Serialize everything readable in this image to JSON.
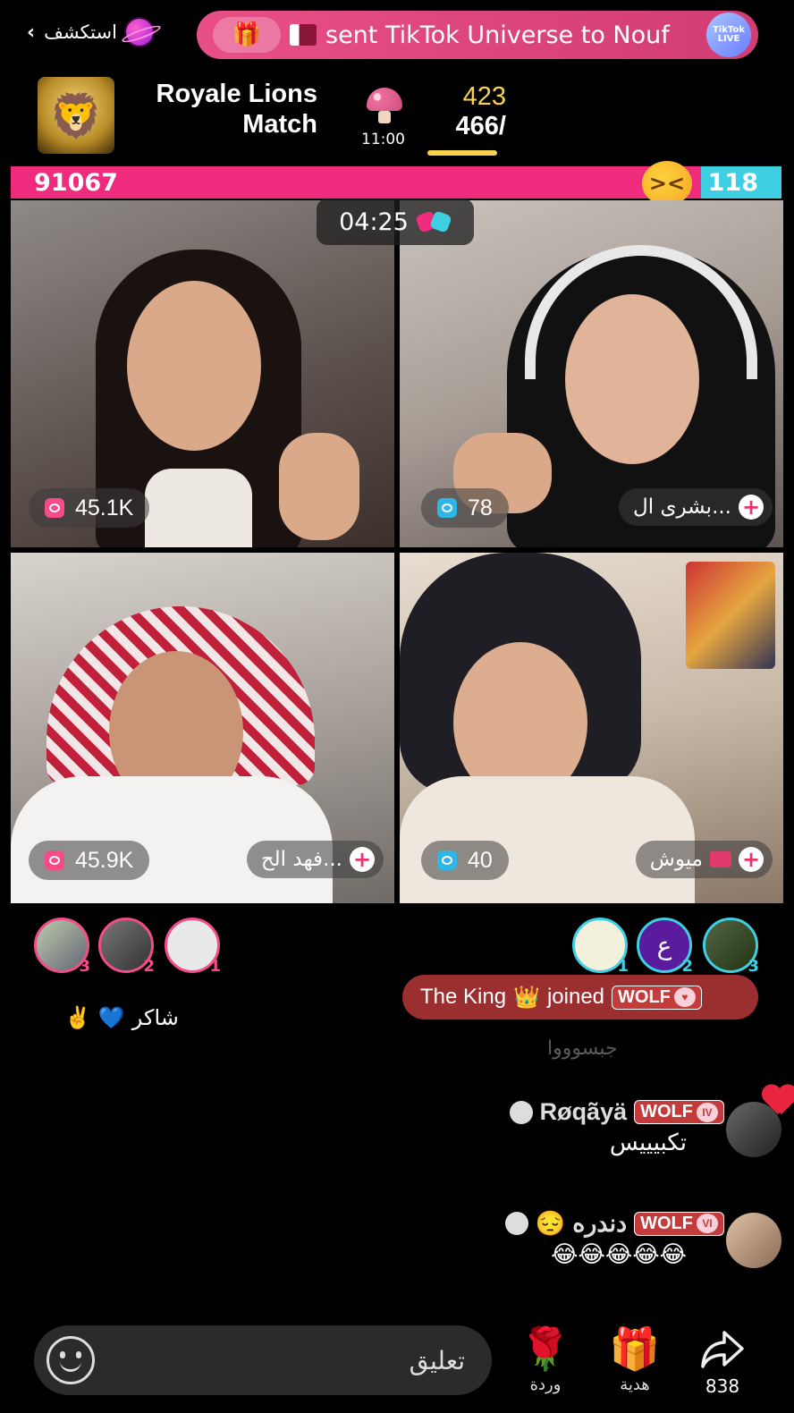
{
  "header": {
    "explore_label": "استكشف",
    "gift_text": "sent TikTok Universe to Nouf",
    "live_badge": "TikTok LIVE"
  },
  "match": {
    "title": "Royale Lions Match",
    "mushroom_time": "11:00",
    "score_top": "423",
    "score_bottom": "466/"
  },
  "battle": {
    "left_score": "91067",
    "right_score": "118",
    "timer": "04:25"
  },
  "cells": [
    {
      "viewers": "45.1K",
      "name": ""
    },
    {
      "viewers": "78",
      "name": "بشرى ال..."
    },
    {
      "viewers": "45.9K",
      "name": "فهد الح..."
    },
    {
      "viewers": "40",
      "name": "ميوش"
    }
  ],
  "gifters_left": [
    {
      "rank": "3"
    },
    {
      "rank": "2"
    },
    {
      "rank": "1"
    }
  ],
  "gifters_right": [
    {
      "rank": "1"
    },
    {
      "rank": "2",
      "letter": "ع"
    },
    {
      "rank": "3"
    }
  ],
  "shaker_text": "شاكر",
  "joined": {
    "name": "The King",
    "text": "joined",
    "badge": "WOLF"
  },
  "faded_comment": "جبسوووا",
  "comments": [
    {
      "user": "Røqãyä",
      "badge": "WOLF",
      "level": "IV",
      "text": "تكبيييس"
    },
    {
      "user": "دندره",
      "badge": "WOLF",
      "level": "VI",
      "text": "😂😂😂😂😂"
    }
  ],
  "bottom": {
    "comment_placeholder": "تعليق",
    "rose_label": "وردة",
    "gift_label": "هدية",
    "share_count": "838"
  }
}
